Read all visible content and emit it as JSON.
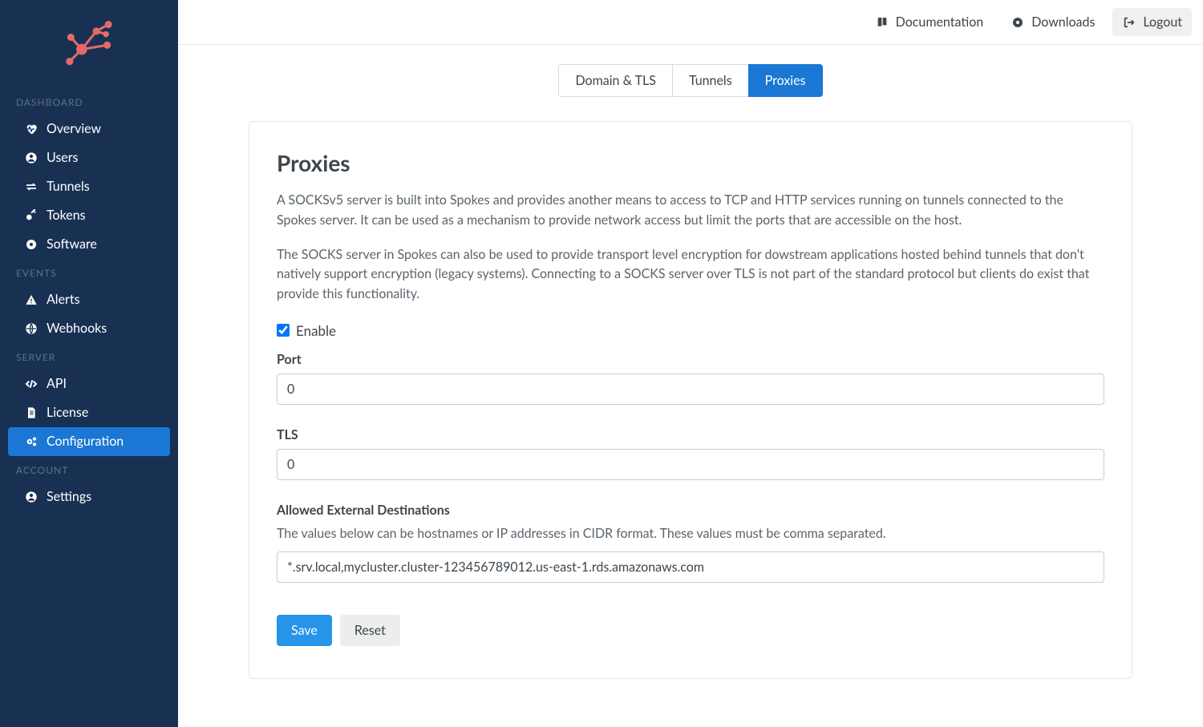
{
  "sidebar": {
    "sections": [
      {
        "title": "DASHBOARD",
        "items": [
          {
            "label": "Overview",
            "icon": "heartbeat"
          },
          {
            "label": "Users",
            "icon": "user-circle"
          },
          {
            "label": "Tunnels",
            "icon": "exchange"
          },
          {
            "label": "Tokens",
            "icon": "key"
          },
          {
            "label": "Software",
            "icon": "disc"
          }
        ]
      },
      {
        "title": "EVENTS",
        "items": [
          {
            "label": "Alerts",
            "icon": "warning"
          },
          {
            "label": "Webhooks",
            "icon": "globe"
          }
        ]
      },
      {
        "title": "SERVER",
        "items": [
          {
            "label": "API",
            "icon": "code"
          },
          {
            "label": "License",
            "icon": "file"
          },
          {
            "label": "Configuration",
            "icon": "cogs",
            "active": true
          }
        ]
      },
      {
        "title": "ACCOUNT",
        "items": [
          {
            "label": "Settings",
            "icon": "user-circle"
          }
        ]
      }
    ]
  },
  "topbar": {
    "documentation": "Documentation",
    "downloads": "Downloads",
    "logout": "Logout"
  },
  "tabs": [
    {
      "label": "Domain & TLS",
      "active": false
    },
    {
      "label": "Tunnels",
      "active": false
    },
    {
      "label": "Proxies",
      "active": true
    }
  ],
  "page": {
    "title": "Proxies",
    "p1": "A SOCKSv5 server is built into Spokes and provides another means to access to TCP and HTTP services running on tunnels connected to the Spokes server. It can be used as a mechanism to provide network access but limit the ports that are accessible on the host.",
    "p2": "The SOCKS server in Spokes can also be used to provide transport level encryption for dowstream applications hosted behind tunnels that don't natively support encryption (legacy systems). Connecting to a SOCKS server over TLS is not part of the standard protocol but clients do exist that provide this functionality.",
    "enable_label": "Enable",
    "enable_checked": true,
    "port_label": "Port",
    "port_value": "0",
    "tls_label": "TLS",
    "tls_value": "0",
    "allowed_label": "Allowed External Destinations",
    "allowed_help": "The values below can be hostnames or IP addresses in CIDR format. These values must be comma separated.",
    "allowed_value": "*.srv.local,mycluster.cluster-123456789012.us-east-1.rds.amazonaws.com",
    "save_label": "Save",
    "reset_label": "Reset"
  }
}
